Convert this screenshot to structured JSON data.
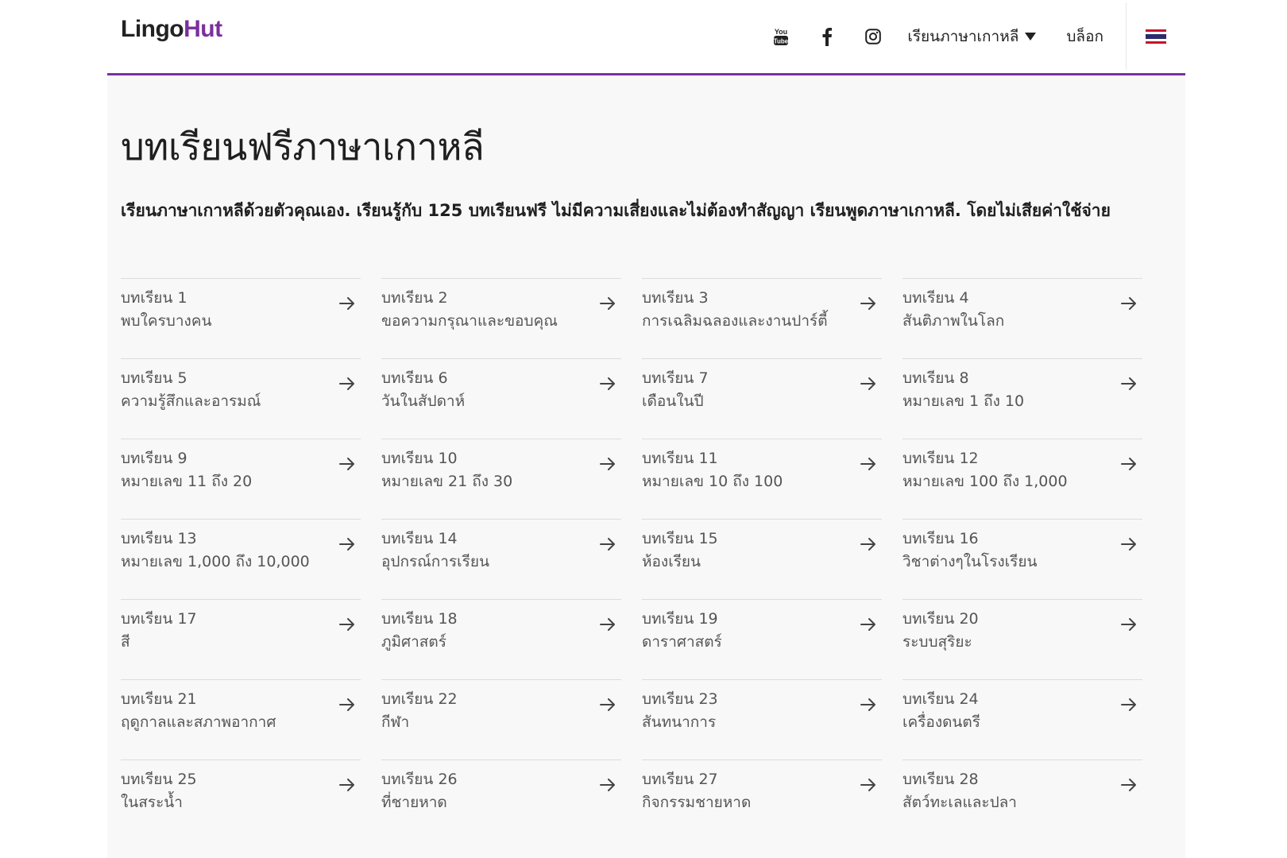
{
  "header": {
    "logo": {
      "part1": "Lingo",
      "part2": "Hut"
    },
    "social": [
      {
        "name": "youtube-icon",
        "label": "YouTube"
      },
      {
        "name": "facebook-icon",
        "label": "f"
      },
      {
        "name": "instagram-icon",
        "label": "Instagram"
      }
    ],
    "language_menu_label": "เรียนภาษาเกาหลี",
    "blog_label": "บล็อก",
    "flag": "thailand-flag-icon"
  },
  "colors": {
    "accent": "#7b2f9e",
    "background": "#f8f8f8",
    "text": "#1f1f1f",
    "muted": "#555555"
  },
  "main": {
    "title": "บทเรียนฟรีภาษาเกาหลี",
    "intro": "เรียนภาษาเกาหลีด้วยตัวคุณเอง. เรียนรู้กับ 125 บทเรียนฟรี ไม่มีความเสี่ยงและไม่ต้องทำสัญญา เรียนพูดภาษาเกาหลี. โดยไม่เสียค่าใช้จ่าย",
    "lessons": [
      {
        "num": "บทเรียน 1",
        "name": "พบใครบางคน"
      },
      {
        "num": "บทเรียน 2",
        "name": "ขอความกรุณาและขอบคุณ"
      },
      {
        "num": "บทเรียน 3",
        "name": "การเฉลิมฉลองและงานปาร์ตี้"
      },
      {
        "num": "บทเรียน 4",
        "name": "สันติภาพในโลก"
      },
      {
        "num": "บทเรียน 5",
        "name": "ความรู้สึกและอารมณ์"
      },
      {
        "num": "บทเรียน 6",
        "name": "วันในสัปดาห์"
      },
      {
        "num": "บทเรียน 7",
        "name": "เดือนในปี"
      },
      {
        "num": "บทเรียน 8",
        "name": "หมายเลข 1 ถึง 10"
      },
      {
        "num": "บทเรียน 9",
        "name": "หมายเลข 11 ถึง 20"
      },
      {
        "num": "บทเรียน 10",
        "name": "หมายเลข 21 ถึง 30"
      },
      {
        "num": "บทเรียน 11",
        "name": "หมายเลข 10 ถึง 100"
      },
      {
        "num": "บทเรียน 12",
        "name": "หมายเลข 100 ถึง 1,000"
      },
      {
        "num": "บทเรียน 13",
        "name": "หมายเลข 1,000 ถึง 10,000"
      },
      {
        "num": "บทเรียน 14",
        "name": "อุปกรณ์การเรียน"
      },
      {
        "num": "บทเรียน 15",
        "name": "ห้องเรียน"
      },
      {
        "num": "บทเรียน 16",
        "name": "วิชาต่างๆในโรงเรียน"
      },
      {
        "num": "บทเรียน 17",
        "name": "สี"
      },
      {
        "num": "บทเรียน 18",
        "name": "ภูมิศาสตร์"
      },
      {
        "num": "บทเรียน 19",
        "name": "ดาราศาสตร์"
      },
      {
        "num": "บทเรียน 20",
        "name": "ระบบสุริยะ"
      },
      {
        "num": "บทเรียน 21",
        "name": "ฤดูกาลและสภาพอากาศ"
      },
      {
        "num": "บทเรียน 22",
        "name": "กีฬา"
      },
      {
        "num": "บทเรียน 23",
        "name": "สันทนาการ"
      },
      {
        "num": "บทเรียน 24",
        "name": "เครื่องดนตรี"
      },
      {
        "num": "บทเรียน 25",
        "name": "ในสระน้ำ"
      },
      {
        "num": "บทเรียน 26",
        "name": "ที่ชายหาด"
      },
      {
        "num": "บทเรียน 27",
        "name": "กิจกรรมชายหาด"
      },
      {
        "num": "บทเรียน 28",
        "name": "สัตว์ทะเลและปลา"
      }
    ]
  }
}
